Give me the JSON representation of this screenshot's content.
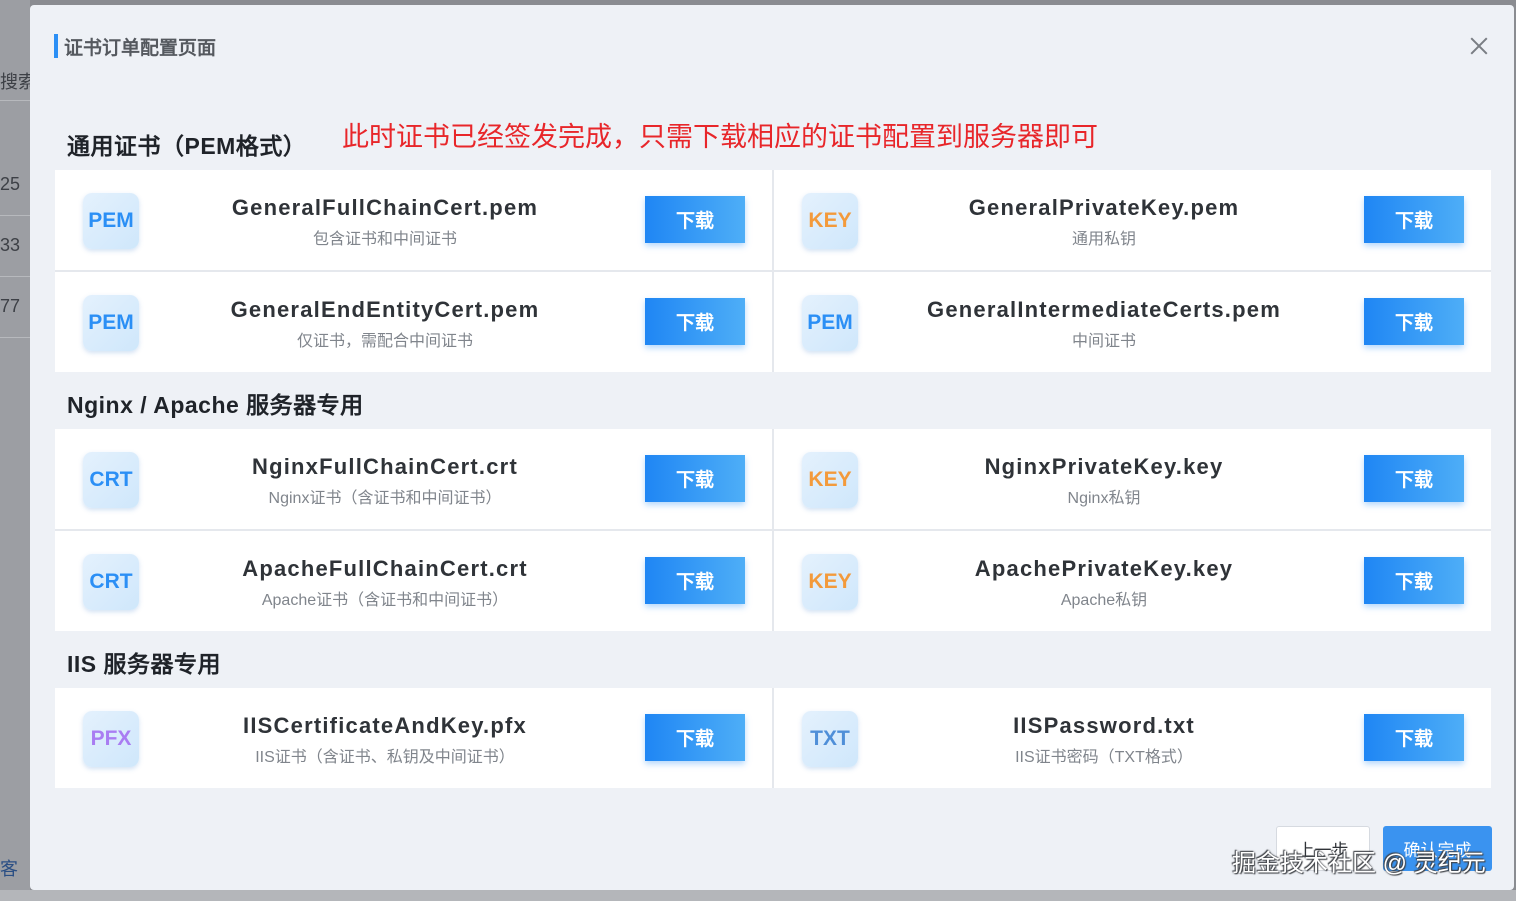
{
  "background": {
    "snippets": [
      "搜索...",
      "25",
      "33",
      "77",
      "客"
    ]
  },
  "modal": {
    "title": "证书订单配置页面",
    "annotation": "此时证书已经签发完成，只需下载相应的证书配置到服务器即可"
  },
  "sections": [
    {
      "title": "通用证书（PEM格式）",
      "files": [
        {
          "badge": "PEM",
          "name": "GeneralFullChainCert.pem",
          "desc": "包含证书和中间证书",
          "button": "下载"
        },
        {
          "badge": "KEY",
          "name": "GeneralPrivateKey.pem",
          "desc": "通用私钥",
          "button": "下载"
        },
        {
          "badge": "PEM",
          "name": "GeneralEndEntityCert.pem",
          "desc": "仅证书，需配合中间证书",
          "button": "下载"
        },
        {
          "badge": "PEM",
          "name": "GeneralIntermediateCerts.pem",
          "desc": "中间证书",
          "button": "下载"
        }
      ]
    },
    {
      "title": "Nginx / Apache 服务器专用",
      "files": [
        {
          "badge": "CRT",
          "name": "NginxFullChainCert.crt",
          "desc": "Nginx证书（含证书和中间证书）",
          "button": "下载"
        },
        {
          "badge": "KEY",
          "name": "NginxPrivateKey.key",
          "desc": "Nginx私钥",
          "button": "下载"
        },
        {
          "badge": "CRT",
          "name": "ApacheFullChainCert.crt",
          "desc": "Apache证书（含证书和中间证书）",
          "button": "下载"
        },
        {
          "badge": "KEY",
          "name": "ApachePrivateKey.key",
          "desc": "Apache私钥",
          "button": "下载"
        }
      ]
    },
    {
      "title": "IIS 服务器专用",
      "files": [
        {
          "badge": "PFX",
          "name": "IISCertificateAndKey.pfx",
          "desc": "IIS证书（含证书、私钥及中间证书）",
          "button": "下载"
        },
        {
          "badge": "TXT",
          "name": "IISPassword.txt",
          "desc": "IIS证书密码（TXT格式）",
          "button": "下载"
        }
      ]
    }
  ],
  "footer": {
    "prev": "上一步",
    "confirm": "确认完成"
  },
  "watermark": "掘金技术社区 @ 灵纪元",
  "colors": {
    "primary": "#2b8ff5",
    "annotation": "#e8262a",
    "key_badge": "#f39a3b",
    "pfx_badge": "#a97df2"
  }
}
